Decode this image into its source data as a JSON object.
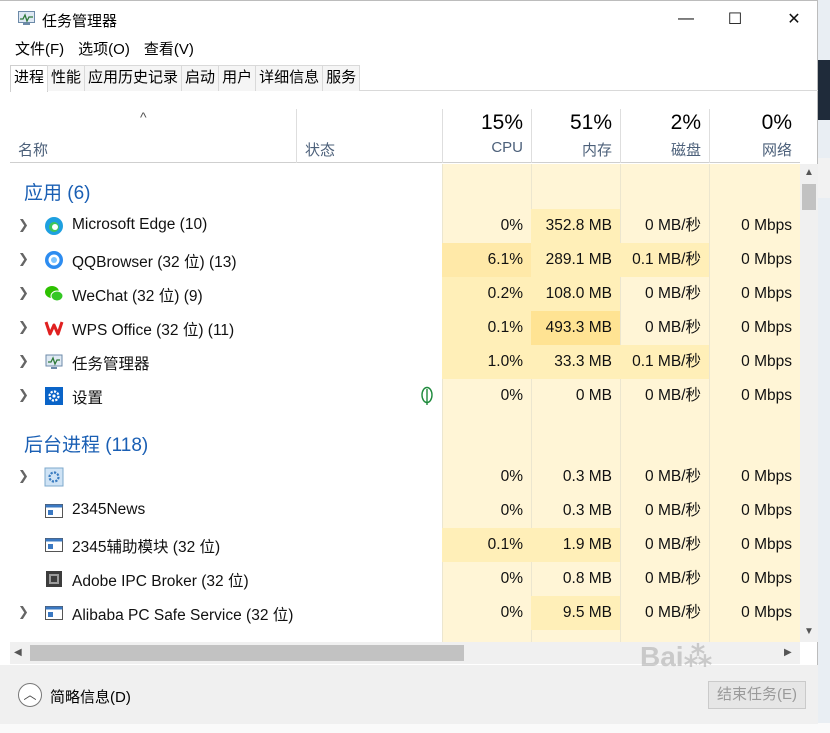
{
  "window": {
    "title": "任务管理器",
    "controls": {
      "minimize": "—",
      "maximize": "☐",
      "close": "✕"
    }
  },
  "menu": [
    "文件(F)",
    "选项(O)",
    "查看(V)"
  ],
  "tabs": [
    {
      "label": "进程",
      "active": true
    },
    {
      "label": "性能"
    },
    {
      "label": "应用历史记录"
    },
    {
      "label": "启动"
    },
    {
      "label": "用户"
    },
    {
      "label": "详细信息"
    },
    {
      "label": "服务"
    }
  ],
  "columns": {
    "sort_indicator": "^",
    "name": "名称",
    "status": "状态",
    "cpu": {
      "pct": "15%",
      "label": "CPU"
    },
    "memory": {
      "pct": "51%",
      "label": "内存"
    },
    "disk": {
      "pct": "2%",
      "label": "磁盘"
    },
    "network": {
      "pct": "0%",
      "label": "网络"
    }
  },
  "groups": {
    "apps": "应用 (6)",
    "background": "后台进程 (118)"
  },
  "processes": [
    {
      "name": "Microsoft Edge (10)",
      "icon": "edge-icon",
      "expand": true,
      "cpu": "0%",
      "mem": "352.8 MB",
      "disk": "0 MB/秒",
      "net": "0 Mbps"
    },
    {
      "name": "QQBrowser (32 位) (13)",
      "icon": "qqbrowser-icon",
      "expand": true,
      "cpu": "6.1%",
      "mem": "289.1 MB",
      "disk": "0.1 MB/秒",
      "net": "0 Mbps"
    },
    {
      "name": "WeChat (32 位) (9)",
      "icon": "wechat-icon",
      "expand": true,
      "cpu": "0.2%",
      "mem": "108.0 MB",
      "disk": "0 MB/秒",
      "net": "0 Mbps"
    },
    {
      "name": "WPS Office (32 位) (11)",
      "icon": "wps-icon",
      "expand": true,
      "cpu": "0.1%",
      "mem": "493.3 MB",
      "disk": "0 MB/秒",
      "net": "0 Mbps"
    },
    {
      "name": "任务管理器",
      "icon": "task-manager-icon",
      "expand": true,
      "cpu": "1.0%",
      "mem": "33.3 MB",
      "disk": "0.1 MB/秒",
      "net": "0 Mbps"
    },
    {
      "name": "设置",
      "icon": "settings-gear-icon",
      "expand": true,
      "cpu": "0%",
      "mem": "0 MB",
      "disk": "0 MB/秒",
      "net": "0 Mbps",
      "status_icon": "leaf-icon"
    },
    {
      "name": "",
      "icon": "service-gear-icon",
      "expand": true,
      "cpu": "0%",
      "mem": "0.3 MB",
      "disk": "0 MB/秒",
      "net": "0 Mbps"
    },
    {
      "name": "2345News",
      "icon": "app-window-icon",
      "expand": false,
      "cpu": "0%",
      "mem": "0.3 MB",
      "disk": "0 MB/秒",
      "net": "0 Mbps"
    },
    {
      "name": "2345辅助模块 (32 位)",
      "icon": "app-window-icon",
      "expand": false,
      "cpu": "0.1%",
      "mem": "1.9 MB",
      "disk": "0 MB/秒",
      "net": "0 Mbps"
    },
    {
      "name": "Adobe IPC Broker (32 位)",
      "icon": "adobe-ipc-icon",
      "expand": false,
      "cpu": "0%",
      "mem": "0.8 MB",
      "disk": "0 MB/秒",
      "net": "0 Mbps"
    },
    {
      "name": "Alibaba PC Safe Service (32 位)",
      "icon": "app-window-icon",
      "expand": true,
      "cpu": "0%",
      "mem": "9.5 MB",
      "disk": "0 MB/秒",
      "net": "0 Mbps"
    }
  ],
  "footer": {
    "fewer_details": "简略信息(D)",
    "end_task": "结束任务(E)"
  },
  "colors": {
    "accent_blue": "#1a5fb4",
    "cell_light": "#fff5d6",
    "cell_medium": "#ffefb8",
    "cell_strong": "#ffe393"
  }
}
